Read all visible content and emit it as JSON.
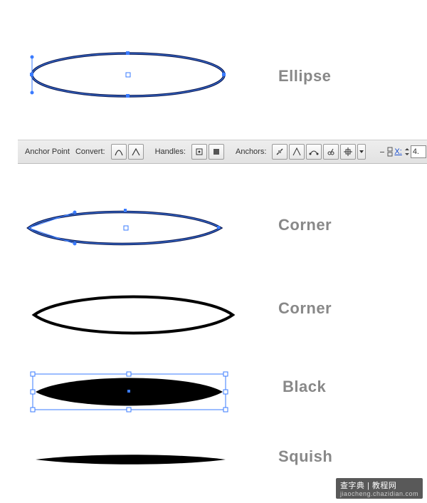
{
  "labels": {
    "ellipse": "Ellipse",
    "corner1": "Corner",
    "corner2": "Corner",
    "black": "Black",
    "squish": "Squish"
  },
  "toolbar": {
    "anchor_point": "Anchor Point",
    "convert": "Convert:",
    "handles": "Handles:",
    "anchors": "Anchors:",
    "x_label": "X:",
    "x_value": "4."
  },
  "watermark": {
    "main": "查字典 | 教程网",
    "sub": "jiaocheng.chazidian.com"
  }
}
